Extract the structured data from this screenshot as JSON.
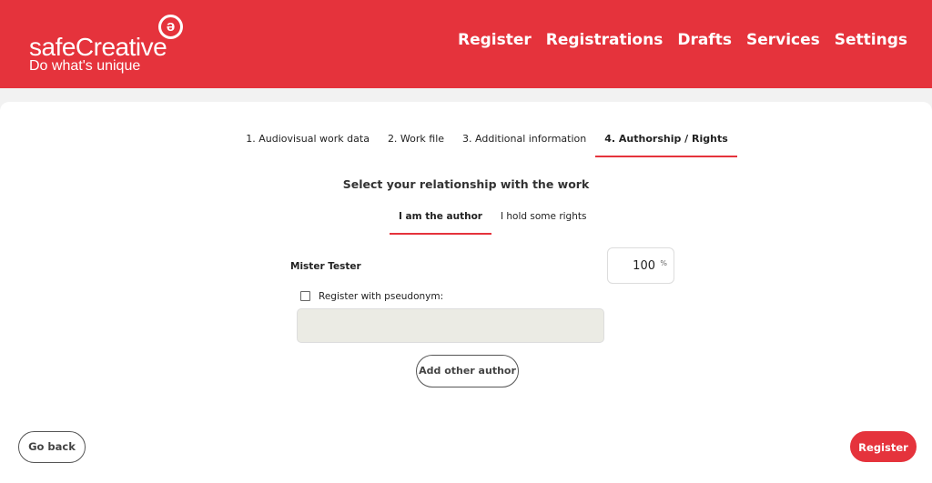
{
  "header": {
    "logo_text": "safeCreative",
    "logo_tagline": "Do what's unique",
    "nav": [
      "Register",
      "Registrations",
      "Drafts",
      "Services",
      "Settings"
    ],
    "brand_color": "#e5333c"
  },
  "steps": [
    "1. Audiovisual work data",
    "2. Work file",
    "3. Additional information",
    "4. Authorship / Rights"
  ],
  "active_step": 3,
  "question": "Select your relationship with the work",
  "relationship_tabs": [
    "I am the author",
    "I hold some rights"
  ],
  "author": {
    "name": "Mister Tester",
    "percentage": "100",
    "percent_sign": "%",
    "pseudonym_label": "Register with pseudonym:",
    "pseudonym_checked": false,
    "pseudonym_value": ""
  },
  "buttons": {
    "add_author": "Add other author",
    "back": "Go back",
    "register": "Register"
  }
}
